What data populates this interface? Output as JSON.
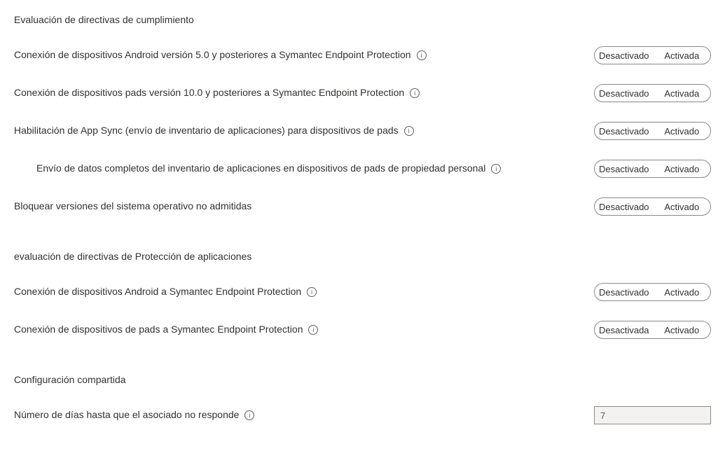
{
  "sections": {
    "compliance": {
      "heading": "Evaluación de directivas de cumplimiento"
    },
    "app_protection": {
      "heading": "evaluación de directivas de Protección de aplicaciones"
    },
    "shared": {
      "heading": "Configuración compartida"
    }
  },
  "toggle_labels": {
    "off": "Desactivado",
    "on": "Activada",
    "off_alt": "Desactivada",
    "on_m": "Activado"
  },
  "settings": {
    "android_compliance": {
      "label": "Conexión de dispositivos Android versión 5.0 y posteriores a Symantec Endpoint Protection"
    },
    "pads_compliance": {
      "label": "Conexión de dispositivos pads versión 10.0 y posteriores a Symantec Endpoint Protection"
    },
    "app_sync": {
      "label": "Habilitación de App Sync (envío de inventario de aplicaciones) para dispositivos de pads"
    },
    "full_inventory": {
      "label": "Envío de datos completos del inventario de aplicaciones en dispositivos de pads de propiedad personal"
    },
    "block_unsupported": {
      "label": "Bloquear versiones del sistema operativo no admitidas"
    },
    "android_app_protection": {
      "label": "Conexión de dispositivos Android a Symantec Endpoint Protection"
    },
    "pads_app_protection": {
      "label": "Conexión de dispositivos de pads a Symantec Endpoint Protection"
    },
    "days_until_unresponsive": {
      "label": "Número de días hasta que el asociado no responde",
      "value": "7"
    }
  }
}
